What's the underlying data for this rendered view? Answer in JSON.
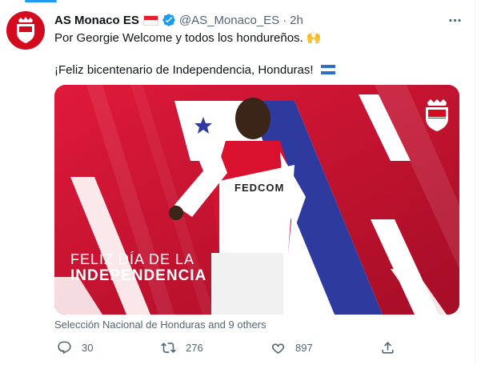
{
  "tweet": {
    "display_name": "AS Monaco ES",
    "handle": "@AS_Monaco_ES",
    "separator": "·",
    "time": "2h",
    "text_line1": "Por Georgie Welcome y todos los hondureños.",
    "text_line2": "¡Feliz bicentenario de Independencia, Honduras!",
    "emoji_hands": "🙌"
  },
  "media": {
    "headline_line1": "FELÍZ DÍA DE LA",
    "headline_line2": "INDEPENDENCIA",
    "jersey_text": "FEDCOM",
    "crest_text": "MONACO"
  },
  "tags": "Selección Nacional de Honduras and 9 others",
  "actions": {
    "replies": "30",
    "retweets": "276",
    "likes": "897"
  },
  "colors": {
    "accent": "#1d9bf0",
    "monaco_red": "#c8102e",
    "honduras_blue": "#2f3a9e"
  }
}
